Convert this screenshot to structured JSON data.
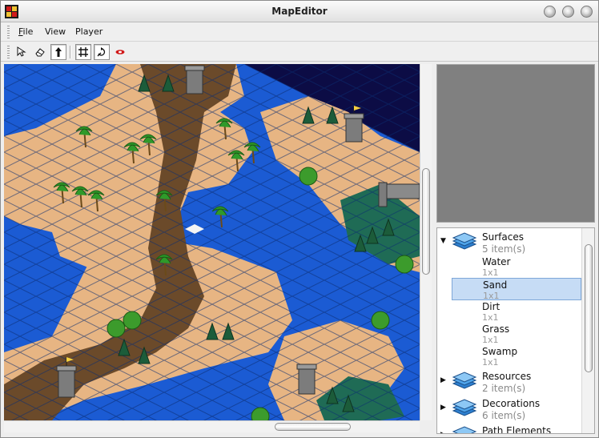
{
  "window": {
    "title": "MapEditor"
  },
  "menu": [
    {
      "label": "File",
      "mnemonic": "F",
      "rest": "ile"
    },
    {
      "label": "View",
      "mnemonic": "",
      "rest": "View"
    },
    {
      "label": "Player",
      "mnemonic": "",
      "rest": "Player"
    }
  ],
  "toolbar": [
    {
      "icon": "select-arrow-icon",
      "pressed": false
    },
    {
      "icon": "eraser-icon",
      "pressed": false
    },
    {
      "icon": "raise-arrow-icon",
      "pressed": true
    },
    {
      "icon": "grid-icon",
      "pressed": true
    },
    {
      "icon": "rotate-icon",
      "pressed": true
    },
    {
      "icon": "red-eye-icon",
      "pressed": false
    }
  ],
  "palette": {
    "categories": [
      {
        "name": "Surfaces",
        "count": "5 item(s)",
        "expanded": true,
        "items": [
          {
            "name": "Water",
            "size": "1x1"
          },
          {
            "name": "Sand",
            "size": "1x1",
            "selected": true
          },
          {
            "name": "Dirt",
            "size": "1x1"
          },
          {
            "name": "Grass",
            "size": "1x1"
          },
          {
            "name": "Swamp",
            "size": "1x1"
          }
        ]
      },
      {
        "name": "Resources",
        "count": "2 item(s)",
        "expanded": false
      },
      {
        "name": "Decorations",
        "count": "6 item(s)",
        "expanded": false
      },
      {
        "name": "Path Elements",
        "count": "",
        "expanded": false
      }
    ]
  },
  "colors": {
    "water": "#1b5bd3",
    "sand": "#e7b583",
    "dirt": "#6b4a2a",
    "swamp": "#1f6b55",
    "void": "#0c0c45",
    "selection": "#c6dcf5"
  }
}
